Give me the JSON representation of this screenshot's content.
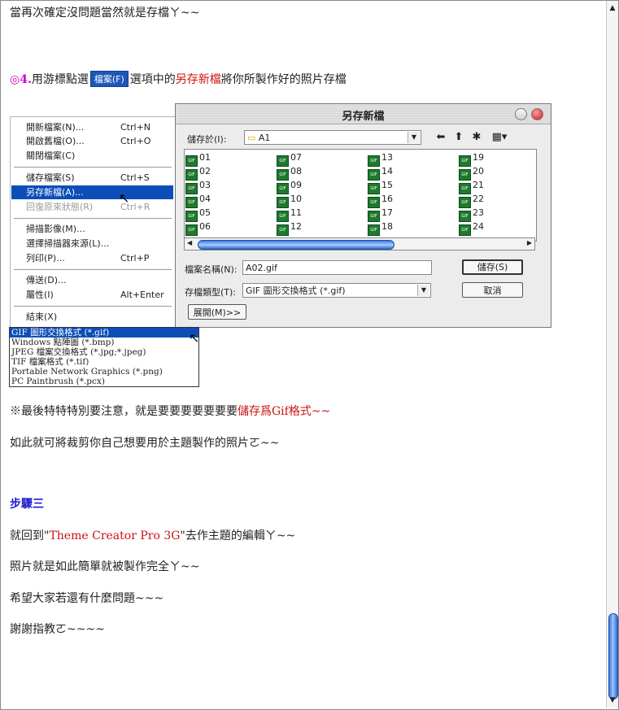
{
  "intro_line": "當再次確定沒問題當然就是存檔ㄚ~~",
  "step4": {
    "num": "◎4.",
    "pre": "用游標點選",
    "badge": "檔案(F)",
    "mid": "選項中的",
    "highlight": "另存新檔",
    "post": "將你所製作好的照片存檔"
  },
  "file_menu": {
    "items": [
      {
        "label": "開新檔案(N)...",
        "shortcut": "Ctrl+N"
      },
      {
        "label": "開啟舊檔(O)...",
        "shortcut": "Ctrl+O"
      },
      {
        "label": "關閉檔案(C)",
        "shortcut": ""
      },
      {
        "label": "儲存檔案(S)",
        "shortcut": "Ctrl+S"
      },
      {
        "label": "另存新檔(A)...",
        "shortcut": ""
      },
      {
        "label": "回復原來狀態(R)",
        "shortcut": "Ctrl+R"
      },
      {
        "label": "掃描影像(M)...",
        "shortcut": ""
      },
      {
        "label": "選擇掃描器來源(L)...",
        "shortcut": ""
      },
      {
        "label": "列印(P)...",
        "shortcut": "Ctrl+P"
      },
      {
        "label": "傳送(D)...",
        "shortcut": ""
      },
      {
        "label": "屬性(I)",
        "shortcut": "Alt+Enter"
      },
      {
        "label": "結束(X)",
        "shortcut": ""
      }
    ]
  },
  "dialog": {
    "title": "另存新檔",
    "save_in_label": "儲存於(I):",
    "save_in_value": "A1",
    "files": [
      "01",
      "02",
      "03",
      "04",
      "05",
      "06",
      "07",
      "08",
      "09",
      "10",
      "11",
      "12",
      "13",
      "14",
      "15",
      "16",
      "17",
      "18",
      "19",
      "20",
      "21",
      "22",
      "23",
      "24"
    ],
    "filename_label": "檔案名稱(N):",
    "filename_value": "A02.gif",
    "filetype_label": "存檔類型(T):",
    "filetype_value": "GIF 圖形交換格式 (*.gif)",
    "save_button": "儲存(S)",
    "cancel_button": "取消",
    "expand_button": "展開(M)>>"
  },
  "format_list": [
    "GIF 圖形交換格式 (*.gif)",
    "Windows 點陣圖 (*.bmp)",
    "JPEG 檔案交換格式 (*.jpg;*.jpeg)",
    "TIF 檔案格式 (*.tif)",
    "Portable Network Graphics (*.png)",
    "PC Paintbrush (*.pcx)"
  ],
  "note": {
    "pre": "※最後特特特別要注意，就是要要要要要要要",
    "highlight": "儲存爲Gif格式~~"
  },
  "line_crop": "如此就可將裁剪你自己想要用於主題製作的照片ㄛ~~",
  "step3_heading": "步驟三",
  "return_line": {
    "pre": "就回到\"",
    "app": "Theme Creator Pro 3G",
    "post": "\"去作主題的編輯ㄚ~~"
  },
  "line_done": "照片就是如此簡單就被製作完全ㄚ~~",
  "line_hope": "希望大家若還有什麼問題~~~",
  "line_thanks": "謝謝指教ㄛ~~~~"
}
